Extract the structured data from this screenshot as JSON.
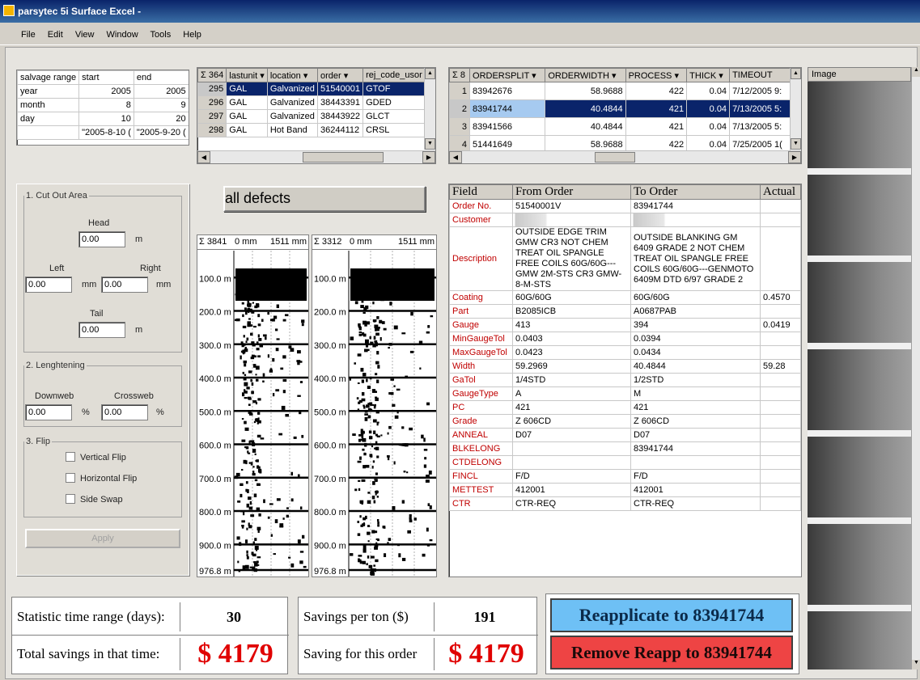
{
  "window": {
    "title": "parsytec 5i Surface Excel -"
  },
  "menu": [
    "File",
    "Edit",
    "View",
    "Window",
    "Tools",
    "Help"
  ],
  "salvage": {
    "headers": [
      "salvage range",
      "start",
      "end"
    ],
    "rows": [
      [
        "year",
        "2005",
        "2005"
      ],
      [
        "month",
        "8",
        "9"
      ],
      [
        "day",
        "10",
        "20"
      ],
      [
        "",
        "\"2005-8-10 (",
        "\"2005-9-20 ("
      ]
    ]
  },
  "coils": {
    "count": "Σ 364",
    "headers": [
      "lastunit",
      "location",
      "order",
      "rej_code_usor"
    ],
    "rows": [
      [
        "295",
        "GAL",
        "Galvanized",
        "51540001",
        "GTOF"
      ],
      [
        "296",
        "GAL",
        "Galvanized",
        "38443391",
        "GDED"
      ],
      [
        "297",
        "GAL",
        "Galvanized",
        "38443922",
        "GLCT"
      ],
      [
        "298",
        "GAL",
        "Hot Band",
        "36244112",
        "CRSL"
      ]
    ]
  },
  "orders": {
    "count": "Σ 8",
    "headers": [
      "ORDERSPLIT",
      "ORDERWIDTH",
      "PROCESS",
      "THICK",
      "TIMEOUT"
    ],
    "rows": [
      [
        "1",
        "83942676",
        "58.9688",
        "422",
        "0.04",
        "7/12/2005 9:"
      ],
      [
        "2",
        "83941744",
        "40.4844",
        "421",
        "0.04",
        "7/13/2005 5:"
      ],
      [
        "3",
        "83941566",
        "40.4844",
        "421",
        "0.04",
        "7/13/2005 5:"
      ],
      [
        "4",
        "51441649",
        "58.9688",
        "422",
        "0.04",
        "7/25/2005 1("
      ]
    ]
  },
  "image_panel": {
    "label": "Image"
  },
  "controls": {
    "cut_out_title": "1. Cut Out Area",
    "head_label": "Head",
    "head_value": "0.00",
    "head_unit": "m",
    "left_label": "Left",
    "left_value": "0.00",
    "left_unit": "mm",
    "right_label": "Right",
    "right_value": "0.00",
    "right_unit": "mm",
    "tail_label": "Tail",
    "tail_value": "0.00",
    "tail_unit": "m",
    "lengthening_title": "2. Lenghtening",
    "downweb_label": "Downweb",
    "downweb_value": "0.00",
    "downweb_unit": "%",
    "crossweb_label": "Crossweb",
    "crossweb_value": "0.00",
    "crossweb_unit": "%",
    "flip_title": "3. Flip",
    "vertical_flip": "Vertical Flip",
    "horizontal_flip": "Horizontal Flip",
    "side_swap": "Side Swap",
    "apply": "Apply"
  },
  "defects_button": "all defects",
  "maps": [
    {
      "count": "Σ 3841",
      "left_label": "0 mm",
      "right_label": "1511 mm"
    },
    {
      "count": "Σ 3312",
      "left_label": "0 mm",
      "right_label": "1511 mm"
    }
  ],
  "map_ticks": [
    "100.0 m",
    "200.0 m",
    "300.0 m",
    "400.0 m",
    "500.0 m",
    "600.0 m",
    "700.0 m",
    "800.0 m",
    "900.0 m",
    "976.8 m"
  ],
  "detail": {
    "headers": [
      "Field",
      "From Order",
      "To Order",
      "Actual"
    ],
    "rows": [
      [
        "Order No.",
        "51540001V",
        "83941744",
        ""
      ],
      [
        "Customer",
        "",
        "",
        ""
      ],
      [
        "Description",
        "OUTSIDE EDGE TRIM GMW CR3 NOT CHEM TREAT OIL SPANGLE FREE COILS 60G/60G---GMW 2M-STS CR3 GMW-8-M-STS",
        "OUTSIDE BLANKING GM 6409 GRADE 2 NOT CHEM TREAT OIL SPANGLE FREE COILS 60G/60G---GENMOTO 6409M DTD 6/97 GRADE 2",
        ""
      ],
      [
        "Coating",
        "60G/60G",
        "60G/60G",
        "0.4570"
      ],
      [
        "Part",
        "B2085ICB",
        "A0687PAB",
        ""
      ],
      [
        "Gauge",
        "413",
        "394",
        "0.0419"
      ],
      [
        "MinGaugeTol",
        "0.0403",
        "0.0394",
        ""
      ],
      [
        "MaxGaugeTol",
        "0.0423",
        "0.0434",
        ""
      ],
      [
        "Width",
        "59.2969",
        "40.4844",
        "59.28"
      ],
      [
        "GaTol",
        "1/4STD",
        "1/2STD",
        ""
      ],
      [
        "GaugeType",
        "A",
        "M",
        ""
      ],
      [
        "PC",
        "421",
        "421",
        ""
      ],
      [
        "Grade",
        "Z 606CD",
        "Z 606CD",
        ""
      ],
      [
        "ANNEAL",
        "D07",
        "D07",
        ""
      ],
      [
        "BLKELONG",
        "",
        "83941744",
        ""
      ],
      [
        "CTDELONG",
        "",
        "",
        ""
      ],
      [
        "FINCL",
        "F/D",
        "F/D",
        ""
      ],
      [
        "METTEST",
        "412001",
        "412001",
        ""
      ],
      [
        "CTR",
        "CTR-REQ",
        "CTR-REQ",
        ""
      ]
    ]
  },
  "stats": {
    "time_range_label": "Statistic time range (days):",
    "time_range_value": "30",
    "total_savings_label": "Total savings in that time:",
    "total_savings_value": "$ 4179",
    "savings_per_ton_label": "Savings per ton ($)",
    "savings_per_ton_value": "191",
    "saving_order_label": "Saving for this order",
    "saving_order_value": "$ 4179"
  },
  "actions": {
    "reapplicate": "Reapplicate to 83941744",
    "remove": "Remove Reapp to 83941744"
  }
}
